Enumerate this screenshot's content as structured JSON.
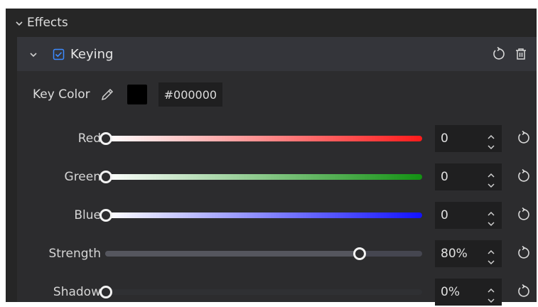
{
  "section": {
    "title": "Effects"
  },
  "effect": {
    "title": "Keying",
    "enabled": true
  },
  "key_color": {
    "label": "Key Color",
    "hex": "#000000",
    "swatch_color": "#000000"
  },
  "params": [
    {
      "label": "Red",
      "value": "0",
      "level": 0
    },
    {
      "label": "Green",
      "value": "0",
      "level": 0
    },
    {
      "label": "Blue",
      "value": "0",
      "level": 0
    },
    {
      "label": "Strength",
      "value": "80%",
      "level": 0.8
    },
    {
      "label": "Shadow",
      "value": "0%",
      "level": 0
    }
  ],
  "colors": {
    "accent": "#3d8bff",
    "red_track_end": "#ff1b1b",
    "green_track_end": "#129112",
    "blue_track_end": "#1212ff"
  },
  "icons": {
    "section_toggle": "chevron-down-icon",
    "effect_toggle": "chevron-down-icon",
    "effect_checkbox": "checkbox-checked-icon",
    "effect_reset": "reset-icon",
    "effect_delete": "trash-icon",
    "eyedropper": "eyedropper-icon",
    "stepper_up": "chevron-up-icon",
    "stepper_down": "chevron-down-icon",
    "param_reset": "reset-icon"
  }
}
